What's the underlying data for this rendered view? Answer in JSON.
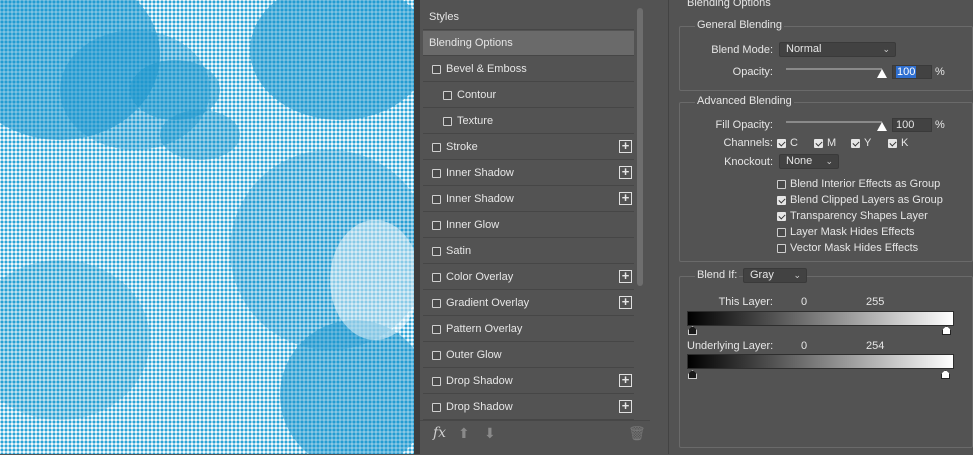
{
  "styles_panel": {
    "header": "Styles",
    "items": [
      {
        "label": "Blending Options",
        "checkbox": false,
        "checked": false,
        "plus": false,
        "selected": true,
        "indent": 0
      },
      {
        "label": "Bevel & Emboss",
        "checkbox": true,
        "checked": false,
        "plus": false,
        "selected": false,
        "indent": 0
      },
      {
        "label": "Contour",
        "checkbox": true,
        "checked": false,
        "plus": false,
        "selected": false,
        "indent": 1
      },
      {
        "label": "Texture",
        "checkbox": true,
        "checked": false,
        "plus": false,
        "selected": false,
        "indent": 1
      },
      {
        "label": "Stroke",
        "checkbox": true,
        "checked": false,
        "plus": true,
        "selected": false,
        "indent": 0
      },
      {
        "label": "Inner Shadow",
        "checkbox": true,
        "checked": false,
        "plus": true,
        "selected": false,
        "indent": 0
      },
      {
        "label": "Inner Shadow",
        "checkbox": true,
        "checked": false,
        "plus": true,
        "selected": false,
        "indent": 0
      },
      {
        "label": "Inner Glow",
        "checkbox": true,
        "checked": false,
        "plus": false,
        "selected": false,
        "indent": 0
      },
      {
        "label": "Satin",
        "checkbox": true,
        "checked": false,
        "plus": false,
        "selected": false,
        "indent": 0
      },
      {
        "label": "Color Overlay",
        "checkbox": true,
        "checked": false,
        "plus": true,
        "selected": false,
        "indent": 0
      },
      {
        "label": "Gradient Overlay",
        "checkbox": true,
        "checked": false,
        "plus": true,
        "selected": false,
        "indent": 0
      },
      {
        "label": "Pattern Overlay",
        "checkbox": true,
        "checked": false,
        "plus": false,
        "selected": false,
        "indent": 0
      },
      {
        "label": "Outer Glow",
        "checkbox": true,
        "checked": false,
        "plus": false,
        "selected": false,
        "indent": 0
      },
      {
        "label": "Drop Shadow",
        "checkbox": true,
        "checked": false,
        "plus": true,
        "selected": false,
        "indent": 0
      },
      {
        "label": "Drop Shadow",
        "checkbox": true,
        "checked": false,
        "plus": true,
        "selected": false,
        "indent": 0
      }
    ],
    "bottom_icons": {
      "fx": "fx",
      "up": "arrow-up-icon",
      "down": "arrow-down-icon",
      "trash": "trash-icon"
    }
  },
  "blending_options": {
    "title": "Blending Options",
    "general": {
      "title": "General Blending",
      "blend_mode_label": "Blend Mode:",
      "blend_mode_value": "Normal",
      "opacity_label": "Opacity:",
      "opacity_value": "100",
      "opacity_unit": "%",
      "opacity_level": 100
    },
    "advanced": {
      "title": "Advanced Blending",
      "fill_opacity_label": "Fill Opacity:",
      "fill_opacity_value": "100",
      "fill_opacity_unit": "%",
      "fill_opacity_level": 100,
      "channels_label": "Channels:",
      "channels": [
        {
          "label": "C",
          "checked": true
        },
        {
          "label": "M",
          "checked": true
        },
        {
          "label": "Y",
          "checked": true
        },
        {
          "label": "K",
          "checked": true
        }
      ],
      "knockout_label": "Knockout:",
      "knockout_value": "None",
      "options": [
        {
          "label": "Blend Interior Effects as Group",
          "checked": false
        },
        {
          "label": "Blend Clipped Layers as Group",
          "checked": true
        },
        {
          "label": "Transparency Shapes Layer",
          "checked": true
        },
        {
          "label": "Layer Mask Hides Effects",
          "checked": false
        },
        {
          "label": "Vector Mask Hides Effects",
          "checked": false
        }
      ]
    },
    "blend_if": {
      "label": "Blend If:",
      "value": "Gray",
      "this_layer_label": "This Layer:",
      "this_layer_low": "0",
      "this_layer_high": "255",
      "underlying_label": "Underlying Layer:",
      "underlying_low": "0",
      "underlying_high": "254"
    }
  },
  "colors": {
    "halftone": "#2aa3d6",
    "selected_row": "#6a6a6a",
    "panel_bg": "#535353",
    "focus": "#2f6fd0"
  }
}
